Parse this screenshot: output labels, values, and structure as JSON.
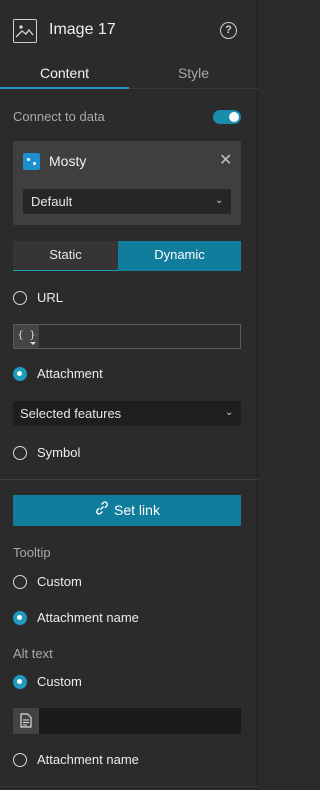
{
  "header": {
    "title": "Image 17",
    "image_icon": "image-icon",
    "help_icon": "question-circle-icon"
  },
  "tabs": [
    {
      "label": "Content",
      "active": true
    },
    {
      "label": "Style",
      "active": false
    }
  ],
  "connect": {
    "label": "Connect to data",
    "enabled": true
  },
  "datasource": {
    "name": "Mosty",
    "view": "Default",
    "icon": "layer-icon"
  },
  "source_toggle": {
    "static": "Static",
    "dynamic": "Dynamic",
    "selected": "Dynamic"
  },
  "image_source": {
    "url_label": "URL",
    "expr_glyph": "{ }",
    "attachment_label": "Attachment",
    "attachment_select": "Selected features",
    "symbol_label": "Symbol",
    "selected": "Attachment"
  },
  "set_link": {
    "label": "Set link",
    "icon": "link-icon"
  },
  "tooltip": {
    "label": "Tooltip",
    "custom": "Custom",
    "attachment_name": "Attachment name",
    "selected": "Attachment name"
  },
  "alt_text": {
    "label": "Alt text",
    "custom": "Custom",
    "attachment_name": "Attachment name",
    "selected": "Custom"
  },
  "colors": {
    "accent": "#1e9bbd",
    "button": "#0f7d9b",
    "panel": "#2b2b2b"
  }
}
